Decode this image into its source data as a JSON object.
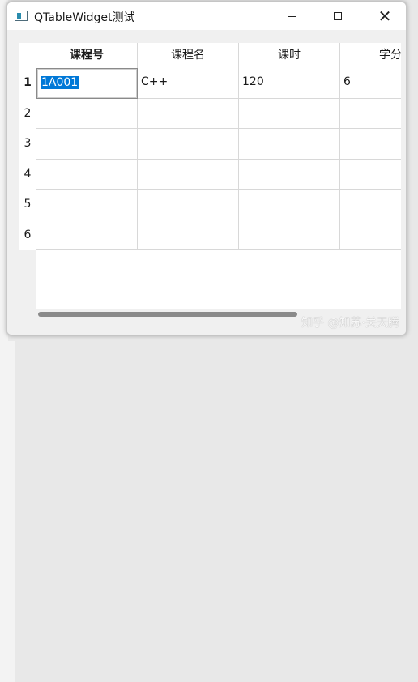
{
  "window": {
    "title": "QTableWidget测试"
  },
  "table": {
    "columns": [
      {
        "label": "课程号",
        "bold": true
      },
      {
        "label": "课程名",
        "bold": false
      },
      {
        "label": "课时",
        "bold": false
      },
      {
        "label": "学分",
        "bold": false
      }
    ],
    "row_labels": [
      "1",
      "2",
      "3",
      "4",
      "5",
      "6"
    ],
    "rows": [
      [
        "1A001",
        "C++",
        "120",
        "6"
      ],
      [
        "",
        "",
        "",
        ""
      ],
      [
        "",
        "",
        "",
        ""
      ],
      [
        "",
        "",
        "",
        ""
      ],
      [
        "",
        "",
        "",
        ""
      ],
      [
        "",
        "",
        "",
        ""
      ]
    ],
    "current_cell": {
      "row": 0,
      "col": 0
    }
  },
  "watermark": "知乎 @知苏·关天腾"
}
